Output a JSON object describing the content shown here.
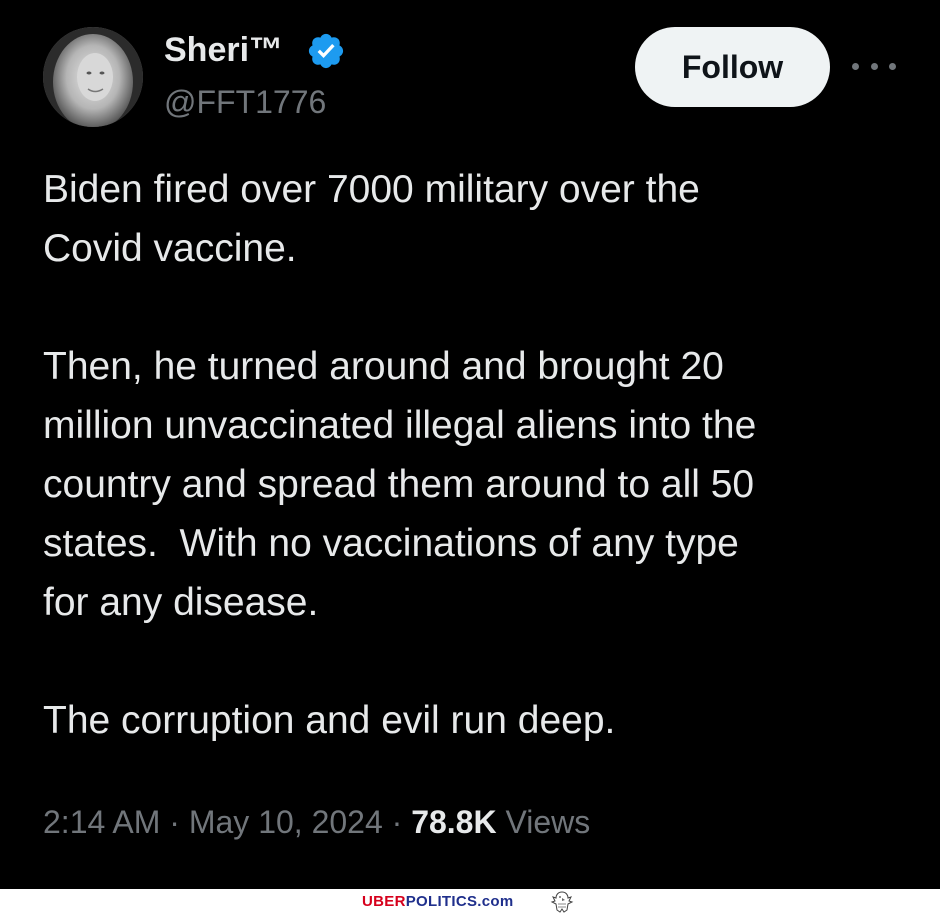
{
  "user": {
    "display_name": "Sheri™",
    "handle": "@FFT1776",
    "verified": true,
    "avatar_icon": "profile-photo"
  },
  "actions": {
    "follow_label": "Follow",
    "more_icon": "more-horizontal-icon"
  },
  "tweet": {
    "paragraphs": [
      "Biden fired over 7000 military over the\nCovid vaccine.",
      "Then, he turned around and brought 20\nmillion unvaccinated illegal aliens into the\ncountry and spread them around to all 50\nstates.  With no vaccinations of any type\nfor any disease.",
      "The corruption and evil run deep."
    ]
  },
  "meta": {
    "time": "2:14 AM",
    "separator": "·",
    "date": "May 10, 2024",
    "views_count": "78.8K",
    "views_label": "Views"
  },
  "watermark": {
    "part1": "UBER",
    "part2": "POLITICS",
    "part3": ".com"
  },
  "colors": {
    "background": "#000000",
    "text": "#e7e9ea",
    "secondary": "#71767b",
    "verified": "#1d9bf0",
    "follow_bg": "#eff3f4"
  }
}
